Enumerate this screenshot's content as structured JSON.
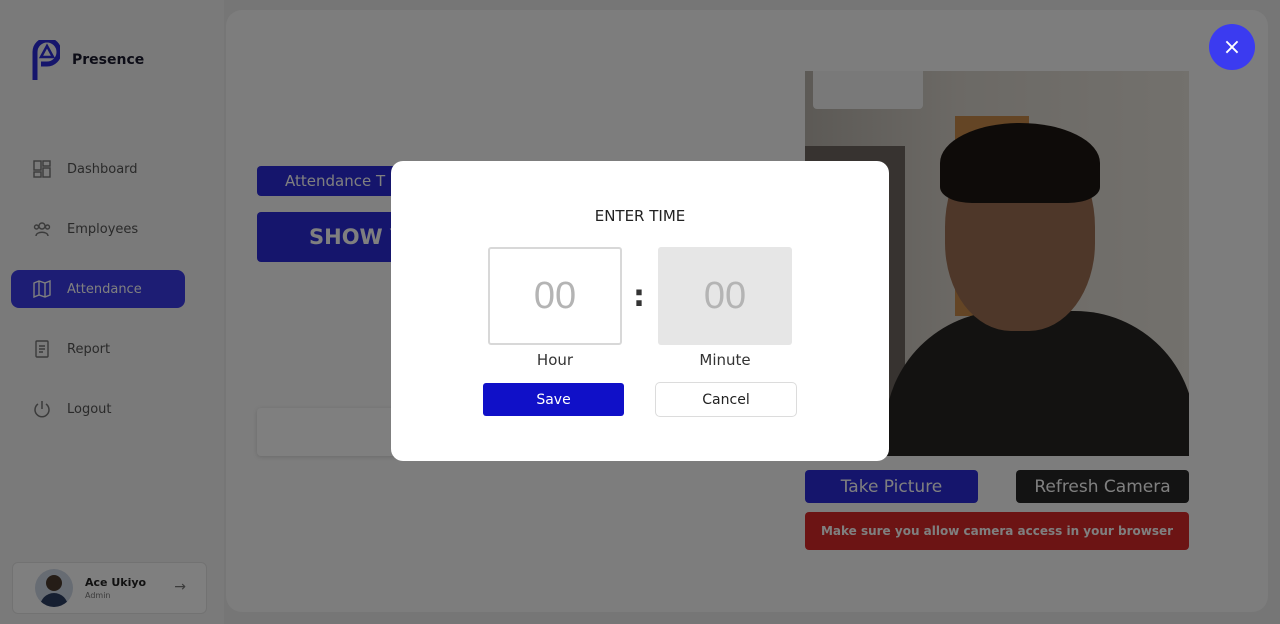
{
  "app": {
    "name": "Presence",
    "accent": "#2a2ad8"
  },
  "sidebar": {
    "items": [
      {
        "label": "Dashboard",
        "icon": "dashboard-grid-icon",
        "active": false
      },
      {
        "label": "Employees",
        "icon": "people-icon",
        "active": false
      },
      {
        "label": "Attendance",
        "icon": "attendance-map-icon",
        "active": true
      },
      {
        "label": "Report",
        "icon": "document-icon",
        "active": false
      },
      {
        "label": "Logout",
        "icon": "power-icon",
        "active": false
      }
    ],
    "profile": {
      "name": "Ace Ukiyo",
      "role": "Admin"
    }
  },
  "main": {
    "attendance_chip": "Attendance T",
    "show_button": "SHOW Y",
    "take_picture": "Take Picture",
    "refresh_camera": "Refresh Camera",
    "camera_warning": "Make sure you allow camera access in your browser"
  },
  "modal": {
    "title": "ENTER TIME",
    "hour_placeholder": "00",
    "minute_placeholder": "00",
    "separator": ":",
    "hour_label": "Hour",
    "minute_label": "Minute",
    "save": "Save",
    "cancel": "Cancel"
  },
  "close_icon": "×"
}
